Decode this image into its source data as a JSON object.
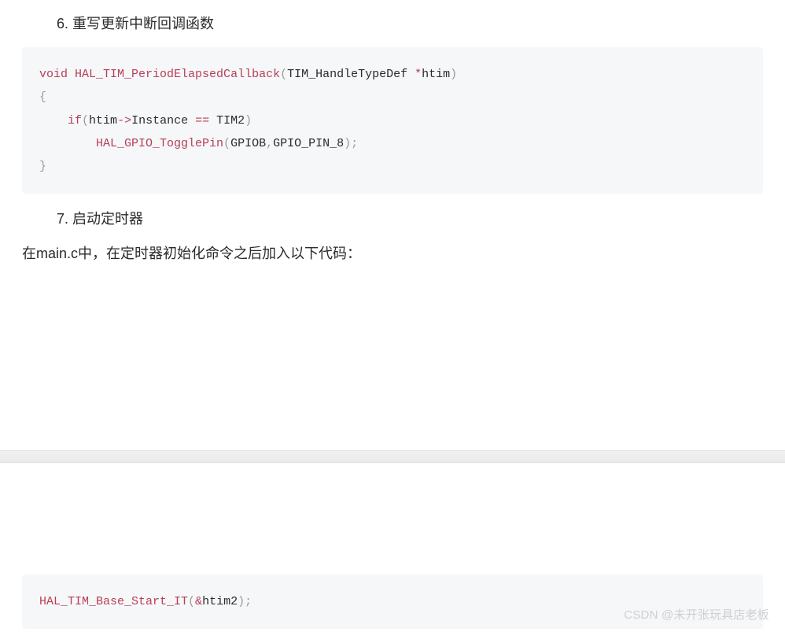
{
  "sections": {
    "step6": {
      "heading": "6. 重写更新中断回调函数"
    },
    "step7": {
      "heading": "7. 启动定时器",
      "para": "在main.c中，在定时器初始化命令之后加入以下代码："
    }
  },
  "code1": {
    "l1": {
      "kw": "void",
      "fn": "HAL_TIM_PeriodElapsedCallback",
      "lp": "(",
      "type": "TIM_HandleTypeDef",
      "sp": " ",
      "star": "*",
      "arg": "htim",
      "rp": ")"
    },
    "l2": {
      "brace": "{"
    },
    "l3": {
      "kw": "if",
      "lp": "(",
      "id1": "htim",
      "arrow": "->",
      "id2": "Instance",
      "eq": " == ",
      "id3": "TIM2",
      "rp": ")"
    },
    "l4": {
      "fn": "HAL_GPIO_TogglePin",
      "lp": "(",
      "arg1": "GPIOB",
      "comma": ",",
      "arg2": "GPIO_PIN_8",
      "rp": ")",
      "semi": ";"
    },
    "l5": {
      "brace": "}"
    }
  },
  "code2": {
    "l1": {
      "fn": "HAL_TIM_Base_Start_IT",
      "lp": "(",
      "amp": "&",
      "arg": "htim2",
      "rp": ")",
      "semi": ";"
    }
  },
  "watermark": "CSDN @未开张玩具店老板"
}
